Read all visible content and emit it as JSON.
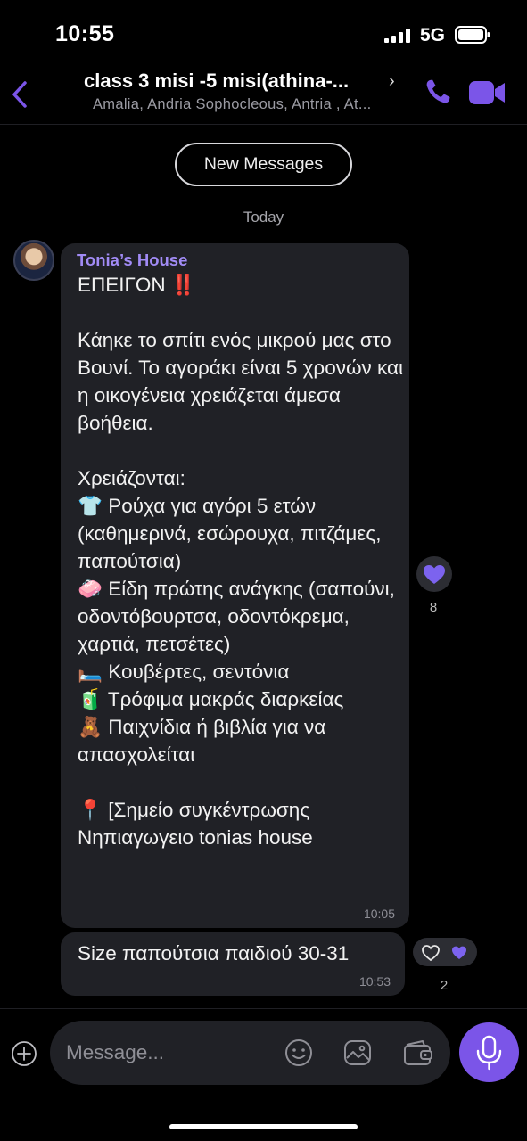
{
  "status_bar": {
    "time": "10:55",
    "network": "5G"
  },
  "header": {
    "title": "class 3 misi -5 misi(athina-...",
    "title_chevron": "›",
    "subtitle": "Amalia, Andria Sophocleous, Antria , At..."
  },
  "divider": {
    "new_messages": "New Messages",
    "day": "Today"
  },
  "messages": [
    {
      "sender": "Tonia’s House",
      "text": "ΕΠΕΙΓΟΝ ‼️\n\nΚάηκε το σπίτι ενός μικρού μας στο Βουνί. Το αγοράκι είναι 5 χρονών και η οικογένεια χρειάζεται άμεσα βοήθεια.\n\nΧρειάζονται:\n👕 Ρούχα για αγόρι 5 ετών (καθημερινά, εσώρουχα, πιτζάμες, παπούτσια)\n🧼 Είδη πρώτης ανάγκης (σαπούνι, οδοντόβουρτσα, οδοντόκρεμα, χαρτιά, πετσέτες)\n🛏️ Κουβέρτες, σεντόνια\n🧃 Τρόφιμα μακράς διαρκείας\n🧸 Παιχνίδια ή βιβλία για να απασχολείται\n\n📍 [Σημείο συγκέντρωσης Νηπιαγωγειο tonias house",
      "time": "10:05",
      "reaction_count": "8"
    },
    {
      "text": "Size παπούτσια παιδιού 30-31",
      "time": "10:53",
      "reaction_count": "2"
    }
  ],
  "composer": {
    "placeholder": "Message..."
  },
  "colors": {
    "accent": "#7b55e8",
    "sender_name": "#a18bf5",
    "bubble": "#202126",
    "background": "#000000"
  },
  "icons": [
    "back-icon",
    "call-icon",
    "video-call-icon",
    "heart-icon",
    "plus-icon",
    "emoji-icon",
    "sticker-icon",
    "wallet-icon",
    "microphone-icon"
  ]
}
